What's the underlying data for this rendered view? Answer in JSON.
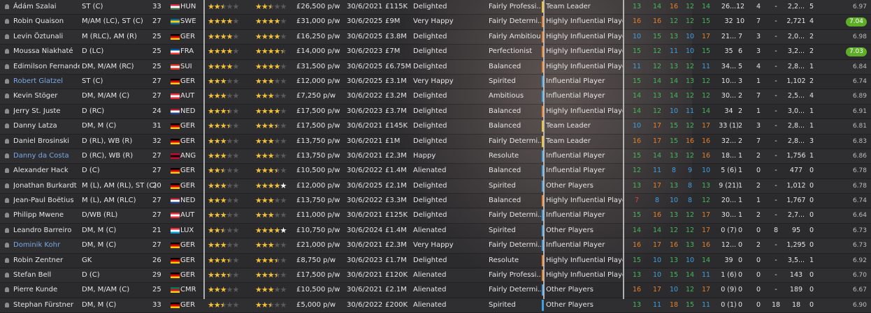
{
  "colors": {
    "yellow": "#f0c030",
    "orange": "#e6802a",
    "blue": "#3fa0e0",
    "green": "#46b85a",
    "red": "#d9463a",
    "grey": "#e6e6e6",
    "rating_bg": "#5fae2a"
  },
  "players": [
    {
      "name": "Ádám Szalai",
      "link": false,
      "pos": "ST (C)",
      "age": "33",
      "nat": "HUN",
      "flag": [
        "#cd2a3e",
        "#ffffff",
        "#436f4d"
      ],
      "ca": 2.5,
      "pa": 2.5,
      "wage": "£26,500 p/w",
      "expires": "30/6/2021",
      "value": "£115K",
      "morale": "Delighted",
      "personality": "Fairly Professi...",
      "status": "Team Leader",
      "bar": "yellow",
      "n": [
        "13",
        "14",
        "16",
        "12",
        "14",
        "26...",
        "12",
        "4",
        "-",
        "2,2...",
        "5"
      ],
      "nc": [
        "green",
        "green",
        "orange",
        "green",
        "green",
        "grey",
        "grey",
        "grey",
        "grey",
        "grey",
        "grey"
      ],
      "rating": "6.97",
      "pill": false
    },
    {
      "name": "Robin Quaison",
      "link": false,
      "pos": "M/AM (LC), ST (C)",
      "age": "27",
      "nat": "SWE",
      "flag": [
        "#006aa7",
        "#fecc00",
        "#006aa7"
      ],
      "ca": 4,
      "pa": 4,
      "wage": "£31,000 p/w",
      "expires": "30/6/2025",
      "value": "£9M",
      "morale": "Very Happy",
      "personality": "Fairly Determi...",
      "status": "Highly Influential Player",
      "bar": "orange",
      "n": [
        "16",
        "16",
        "12",
        "12",
        "15",
        "32",
        "10",
        "7",
        "-",
        "2,721",
        "4"
      ],
      "nc": [
        "orange",
        "orange",
        "green",
        "green",
        "green",
        "grey",
        "grey",
        "grey",
        "grey",
        "grey",
        "grey"
      ],
      "rating": "7.04",
      "pill": true
    },
    {
      "name": "Levin Öztunali",
      "link": false,
      "pos": "M (RLC), AM (R)",
      "age": "25",
      "nat": "GER",
      "flag": [
        "#000000",
        "#dd0000",
        "#ffce00"
      ],
      "ca": 4,
      "pa": 4,
      "wage": "£16,250 p/w",
      "expires": "30/6/2025",
      "value": "£3.8M",
      "morale": "Delighted",
      "personality": "Fairly Ambitious",
      "status": "Highly Influential Player",
      "bar": "orange",
      "n": [
        "10",
        "15",
        "13",
        "10",
        "17",
        "21...",
        "7",
        "3",
        "-",
        "2,0...",
        "2"
      ],
      "nc": [
        "blue",
        "green",
        "green",
        "blue",
        "orange",
        "grey",
        "grey",
        "grey",
        "grey",
        "grey",
        "grey"
      ],
      "rating": "6.98",
      "pill": false
    },
    {
      "name": "Moussa Niakhaté",
      "link": false,
      "pos": "D (LC)",
      "age": "25",
      "nat": "FRA",
      "flag": [
        "#0055a4",
        "#ffffff",
        "#ef4135"
      ],
      "ca": 4,
      "pa": 4.5,
      "wage": "£14,000 p/w",
      "expires": "30/6/2023",
      "value": "£7M",
      "morale": "Delighted",
      "personality": "Perfectionist",
      "status": "Highly Influential Player",
      "bar": "orange",
      "n": [
        "15",
        "12",
        "11",
        "10",
        "15",
        "35",
        "6",
        "3",
        "-",
        "3,2...",
        "2"
      ],
      "nc": [
        "green",
        "green",
        "blue",
        "blue",
        "green",
        "grey",
        "grey",
        "grey",
        "grey",
        "grey",
        "grey"
      ],
      "rating": "7.03",
      "pill": true
    },
    {
      "name": "Edimilson Fernandes",
      "link": false,
      "pos": "DM, M/AM (RC)",
      "age": "25",
      "nat": "SUI",
      "flag": [
        "#d52b1e",
        "#ffffff",
        "#d52b1e"
      ],
      "ca": 4,
      "pa": 4,
      "wage": "£31,500 p/w",
      "expires": "30/6/2025",
      "value": "£6.75M",
      "morale": "Delighted",
      "personality": "Balanced",
      "status": "Highly Influential Player",
      "bar": "orange",
      "n": [
        "11",
        "12",
        "13",
        "12",
        "11",
        "34...",
        "5",
        "4",
        "-",
        "2,8...",
        "1"
      ],
      "nc": [
        "blue",
        "green",
        "green",
        "green",
        "blue",
        "grey",
        "grey",
        "grey",
        "grey",
        "grey",
        "grey"
      ],
      "rating": "6.84",
      "pill": false
    },
    {
      "name": "Robert Glatzel",
      "link": true,
      "pos": "ST (C)",
      "age": "27",
      "nat": "GER",
      "flag": [
        "#000000",
        "#dd0000",
        "#ffce00"
      ],
      "ca": 3,
      "pa": 3,
      "wage": "£12,000 p/w",
      "expires": "30/6/2025",
      "value": "£3.1M",
      "morale": "Very Happy",
      "personality": "Spirited",
      "status": "Influential Player",
      "bar": "blue",
      "n": [
        "15",
        "14",
        "14",
        "13",
        "12",
        "10...",
        "3",
        "1",
        "-",
        "1,102",
        "2"
      ],
      "nc": [
        "green",
        "green",
        "green",
        "green",
        "green",
        "grey",
        "grey",
        "grey",
        "grey",
        "grey",
        "grey"
      ],
      "rating": "6.74",
      "pill": false
    },
    {
      "name": "Kevin Stöger",
      "link": false,
      "pos": "DM, M/AM (C)",
      "age": "27",
      "nat": "AUT",
      "flag": [
        "#ed2939",
        "#ffffff",
        "#ed2939"
      ],
      "ca": 3,
      "pa": 3,
      "wage": "£7,250 p/w",
      "expires": "30/6/2022",
      "value": "£3.2M",
      "morale": "Delighted",
      "personality": "Ambitious",
      "status": "Influential Player",
      "bar": "blue",
      "n": [
        "14",
        "13",
        "14",
        "12",
        "12",
        "30...",
        "2",
        "7",
        "-",
        "2,5...",
        "4"
      ],
      "nc": [
        "green",
        "green",
        "green",
        "green",
        "green",
        "grey",
        "grey",
        "grey",
        "grey",
        "grey",
        "grey"
      ],
      "rating": "6.89",
      "pill": false
    },
    {
      "name": "Jerry St. Juste",
      "link": false,
      "pos": "D (RC)",
      "age": "24",
      "nat": "NED",
      "flag": [
        "#ae1c28",
        "#ffffff",
        "#21468b"
      ],
      "ca": 3.5,
      "pa": 4,
      "wage": "£17,500 p/w",
      "expires": "30/6/2023",
      "value": "£3.7M",
      "morale": "Delighted",
      "personality": "Balanced",
      "status": "Highly Influential Player",
      "bar": "orange",
      "n": [
        "14",
        "12",
        "10",
        "11",
        "14",
        "34",
        "2",
        "1",
        "-",
        "3,0...",
        "1"
      ],
      "nc": [
        "green",
        "green",
        "blue",
        "blue",
        "green",
        "grey",
        "grey",
        "grey",
        "grey",
        "grey",
        "grey"
      ],
      "rating": "6.91",
      "pill": false
    },
    {
      "name": "Danny Latza",
      "link": false,
      "pos": "DM, M (C)",
      "age": "31",
      "nat": "GER",
      "flag": [
        "#000000",
        "#dd0000",
        "#ffce00"
      ],
      "ca": 3.5,
      "pa": 3.5,
      "wage": "£17,500 p/w",
      "expires": "30/6/2021",
      "value": "£145K",
      "morale": "Delighted",
      "personality": "Balanced",
      "status": "Team Leader",
      "bar": "yellow",
      "n": [
        "10",
        "17",
        "15",
        "12",
        "17",
        "33 (1)",
        "2",
        "3",
        "-",
        "2,8...",
        "1"
      ],
      "nc": [
        "blue",
        "orange",
        "green",
        "green",
        "orange",
        "grey",
        "grey",
        "grey",
        "grey",
        "grey",
        "grey"
      ],
      "rating": "6.81",
      "pill": false
    },
    {
      "name": "Daniel Brosinski",
      "link": false,
      "pos": "D (RL), WB (R)",
      "age": "32",
      "nat": "GER",
      "flag": [
        "#000000",
        "#dd0000",
        "#ffce00"
      ],
      "ca": 3,
      "pa": 3,
      "wage": "£13,750 p/w",
      "expires": "30/6/2021",
      "value": "£1M",
      "morale": "Delighted",
      "personality": "Fairly Determi...",
      "status": "Team Leader",
      "bar": "yellow",
      "n": [
        "16",
        "17",
        "15",
        "16",
        "16",
        "32...",
        "2",
        "7",
        "-",
        "2,8...",
        "3"
      ],
      "nc": [
        "orange",
        "orange",
        "green",
        "orange",
        "orange",
        "grey",
        "grey",
        "grey",
        "grey",
        "grey",
        "grey"
      ],
      "rating": "6.83",
      "pill": false
    },
    {
      "name": "Danny da Costa",
      "link": true,
      "pos": "D (RC), WB (R)",
      "age": "27",
      "nat": "ANG",
      "flag": [
        "#cc092f",
        "#000000",
        "#cc092f"
      ],
      "ca": 3,
      "pa": 3,
      "wage": "£13,750 p/w",
      "expires": "30/6/2021",
      "value": "£2.3M",
      "morale": "Happy",
      "personality": "Resolute",
      "status": "Influential Player",
      "bar": "blue",
      "n": [
        "15",
        "14",
        "13",
        "12",
        "16",
        "18...",
        "1",
        "2",
        "-",
        "1,756",
        "1"
      ],
      "nc": [
        "green",
        "green",
        "green",
        "green",
        "orange",
        "grey",
        "grey",
        "grey",
        "grey",
        "grey",
        "grey"
      ],
      "rating": "6.86",
      "pill": false
    },
    {
      "name": "Alexander Hack",
      "link": false,
      "pos": "D (C)",
      "age": "27",
      "nat": "GER",
      "flag": [
        "#000000",
        "#dd0000",
        "#ffce00"
      ],
      "ca": 2.5,
      "pa": 3.5,
      "wage": "£10,500 p/w",
      "expires": "30/6/2022",
      "value": "£1.4M",
      "morale": "Alienated",
      "personality": "Balanced",
      "status": "Influential Player",
      "bar": "blue",
      "n": [
        "12",
        "11",
        "8",
        "9",
        "10",
        "5 (6)",
        "1",
        "0",
        "-",
        "477",
        "0"
      ],
      "nc": [
        "green",
        "blue",
        "blue",
        "blue",
        "blue",
        "grey",
        "grey",
        "grey",
        "grey",
        "grey",
        "grey"
      ],
      "rating": "6.78",
      "pill": false
    },
    {
      "name": "Jonathan Burkardt",
      "link": false,
      "pos": "M (L), AM (RL), ST (C)",
      "age": "20",
      "nat": "GER",
      "flag": [
        "#000000",
        "#dd0000",
        "#ffce00"
      ],
      "ca": 3,
      "pa": 5,
      "pa_white": true,
      "wage": "£12,000 p/w",
      "expires": "30/6/2025",
      "value": "£2.1M",
      "morale": "Delighted",
      "personality": "Spirited",
      "status": "Other Players",
      "bar": "blue",
      "n": [
        "13",
        "17",
        "13",
        "8",
        "13",
        "9 (21)",
        "1",
        "2",
        "-",
        "1,012",
        "0"
      ],
      "nc": [
        "green",
        "orange",
        "green",
        "blue",
        "green",
        "grey",
        "grey",
        "grey",
        "grey",
        "grey",
        "grey"
      ],
      "rating": "6.78",
      "pill": false
    },
    {
      "name": "Jean-Paul Boëtius",
      "link": false,
      "pos": "M (L), AM (RLC)",
      "age": "27",
      "nat": "NED",
      "flag": [
        "#ae1c28",
        "#ffffff",
        "#21468b"
      ],
      "ca": 3,
      "pa": 3,
      "wage": "£13,750 p/w",
      "expires": "30/6/2022",
      "value": "£3.3M",
      "morale": "Delighted",
      "personality": "Balanced",
      "status": "Highly Influential Player",
      "bar": "orange",
      "n": [
        "7",
        "8",
        "10",
        "8",
        "12",
        "20...",
        "1",
        "1",
        "-",
        "1,767",
        "0"
      ],
      "nc": [
        "red",
        "blue",
        "blue",
        "blue",
        "green",
        "grey",
        "grey",
        "grey",
        "grey",
        "grey",
        "grey"
      ],
      "rating": "6.74",
      "pill": false
    },
    {
      "name": "Philipp Mwene",
      "link": false,
      "pos": "D/WB (RL)",
      "age": "27",
      "nat": "AUT",
      "flag": [
        "#ed2939",
        "#ffffff",
        "#ed2939"
      ],
      "ca": 3,
      "pa": 3,
      "wage": "£11,000 p/w",
      "expires": "30/6/2021",
      "value": "£125K",
      "morale": "Delighted",
      "personality": "Fairly Determi...",
      "status": "Influential Player",
      "bar": "blue",
      "n": [
        "15",
        "16",
        "13",
        "12",
        "17",
        "30...",
        "1",
        "2",
        "-",
        "2,7...",
        "0"
      ],
      "nc": [
        "green",
        "orange",
        "green",
        "green",
        "orange",
        "grey",
        "grey",
        "grey",
        "grey",
        "grey",
        "grey"
      ],
      "rating": "6.64",
      "pill": false
    },
    {
      "name": "Leandro Barreiro",
      "link": false,
      "pos": "DM, M (C)",
      "age": "21",
      "nat": "LUX",
      "flag": [
        "#ed2939",
        "#ffffff",
        "#00a1de"
      ],
      "ca": 2.5,
      "pa": 5,
      "pa_white": true,
      "wage": "£10,750 p/w",
      "expires": "30/6/2024",
      "value": "£1.4M",
      "morale": "Alienated",
      "personality": "Spirited",
      "status": "Other Players",
      "bar": "blue",
      "n": [
        "14",
        "14",
        "12",
        "12",
        "17",
        "0 (7)",
        "0",
        "0",
        "8",
        "95",
        "0"
      ],
      "nc": [
        "green",
        "green",
        "green",
        "green",
        "orange",
        "grey",
        "grey",
        "grey",
        "grey",
        "grey",
        "grey"
      ],
      "rating": "6.73",
      "pill": false
    },
    {
      "name": "Dominik Kohr",
      "link": true,
      "pos": "DM, M (C)",
      "age": "27",
      "nat": "GER",
      "flag": [
        "#000000",
        "#dd0000",
        "#ffce00"
      ],
      "ca": 3,
      "pa": 3,
      "wage": "£21,000 p/w",
      "expires": "30/6/2021",
      "value": "£2.3M",
      "morale": "Very Happy",
      "personality": "Fairly Determi...",
      "status": "Influential Player",
      "bar": "blue",
      "n": [
        "16",
        "17",
        "16",
        "13",
        "16",
        "12...",
        "0",
        "2",
        "-",
        "1,295",
        "0"
      ],
      "nc": [
        "orange",
        "orange",
        "orange",
        "green",
        "orange",
        "grey",
        "grey",
        "grey",
        "grey",
        "grey",
        "grey"
      ],
      "rating": "6.73",
      "pill": false
    },
    {
      "name": "Robin Zentner",
      "link": false,
      "pos": "GK",
      "age": "26",
      "nat": "GER",
      "flag": [
        "#000000",
        "#dd0000",
        "#ffce00"
      ],
      "ca": 3.5,
      "pa": 3.5,
      "wage": "£8,750 p/w",
      "expires": "30/6/2023",
      "value": "£1.7M",
      "morale": "Delighted",
      "personality": "Resolute",
      "status": "Highly Influential Player",
      "bar": "orange",
      "n": [
        "15",
        "10",
        "13",
        "10",
        "14",
        "39",
        "0",
        "0",
        "-",
        "3,5...",
        "1"
      ],
      "nc": [
        "green",
        "blue",
        "green",
        "blue",
        "green",
        "grey",
        "grey",
        "grey",
        "grey",
        "grey",
        "grey"
      ],
      "rating": "6.92",
      "pill": false
    },
    {
      "name": "Stefan Bell",
      "link": false,
      "pos": "D (C)",
      "age": "29",
      "nat": "GER",
      "flag": [
        "#000000",
        "#dd0000",
        "#ffce00"
      ],
      "ca": 3.5,
      "pa": 3.5,
      "wage": "£17,500 p/w",
      "expires": "30/6/2021",
      "value": "£120K",
      "morale": "Alienated",
      "personality": "Fairly Professi...",
      "status": "Highly Influential Player",
      "bar": "orange",
      "n": [
        "13",
        "10",
        "15",
        "14",
        "11",
        "1 (6)",
        "0",
        "0",
        "-",
        "143",
        "0"
      ],
      "nc": [
        "green",
        "blue",
        "green",
        "green",
        "blue",
        "grey",
        "grey",
        "grey",
        "grey",
        "grey",
        "grey"
      ],
      "rating": "6.70",
      "pill": false
    },
    {
      "name": "Pierre Kunde",
      "link": false,
      "pos": "DM, M/AM (C)",
      "age": "25",
      "nat": "CMR",
      "flag": [
        "#007a5e",
        "#ce1126",
        "#fcd116"
      ],
      "ca": 3,
      "pa": 3,
      "wage": "£10,500 p/w",
      "expires": "30/6/2021",
      "value": "£2.1M",
      "morale": "Alienated",
      "personality": "Fairly Determi...",
      "status": "Other Players",
      "bar": "blue",
      "n": [
        "16",
        "17",
        "10",
        "12",
        "17",
        "0 (9)",
        "0",
        "0",
        "-",
        "189",
        "0"
      ],
      "nc": [
        "orange",
        "orange",
        "blue",
        "green",
        "orange",
        "grey",
        "grey",
        "grey",
        "grey",
        "grey",
        "grey"
      ],
      "rating": "6.67",
      "pill": false
    },
    {
      "name": "Stephan Fürstner",
      "link": false,
      "pos": "DM, M (C)",
      "age": "33",
      "nat": "GER",
      "flag": [
        "#000000",
        "#dd0000",
        "#ffce00"
      ],
      "ca": 2.5,
      "pa": 2.5,
      "wage": "£5,000 p/w",
      "expires": "30/6/2022",
      "value": "£200K",
      "morale": "Alienated",
      "personality": "Spirited",
      "status": "Other Players",
      "bar": "blue",
      "n": [
        "13",
        "11",
        "18",
        "15",
        "11",
        "0 (1)",
        "0",
        "0",
        "18",
        "18",
        "0"
      ],
      "nc": [
        "green",
        "blue",
        "orange",
        "green",
        "blue",
        "grey",
        "grey",
        "grey",
        "grey",
        "grey",
        "grey"
      ],
      "rating": "6.90",
      "pill": false
    }
  ]
}
